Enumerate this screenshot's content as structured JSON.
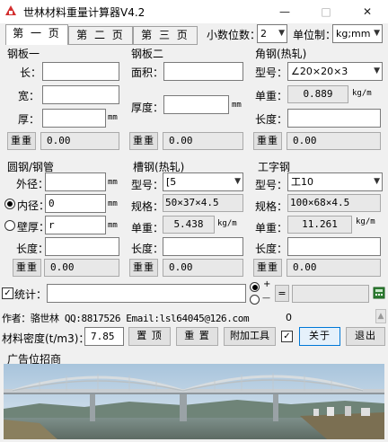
{
  "window": {
    "title": "世林材料重量计算器V4.2",
    "minimize": "—",
    "maximize": "□",
    "close": "✕"
  },
  "tabs": [
    {
      "label": "第 一 页",
      "active": true
    },
    {
      "label": "第 二 页",
      "active": false
    },
    {
      "label": "第 三 页",
      "active": false
    }
  ],
  "settings": {
    "decimals_label": "小数位数：",
    "decimals_value": "2",
    "unit_label": "单位制：",
    "unit_value": "kg;mm"
  },
  "plate1": {
    "title": "钢板一",
    "length_label": "长：",
    "width_label": "宽：",
    "thickness_label": "厚：",
    "length_value": "",
    "width_value": "",
    "thickness_value": "",
    "thickness_unit": "mm",
    "weight_button": "重重",
    "result": "0.00"
  },
  "plate2": {
    "title": "钢板二",
    "area_label": "面积：",
    "thickness_label": "厚度：",
    "area_value": "",
    "thickness_value": "",
    "thickness_unit": "mm",
    "weight_button": "重重",
    "result": "0.00"
  },
  "angle": {
    "title": "角钢(热轧)",
    "model_label": "型号：",
    "model_value": "∠20×20×3",
    "unit_weight_label": "单重：",
    "unit_weight_value": "0.889",
    "unit_weight_unit": "kg/m",
    "length_label": "长度：",
    "length_value": "",
    "weight_button": "重重",
    "result": "0.00"
  },
  "round": {
    "title": "圆钢/钢管",
    "outer_label": "外径：",
    "outer_value": "",
    "outer_unit": "mm",
    "inner_label": "内径：",
    "inner_value": "0",
    "inner_unit": "mm",
    "wall_label": "壁厚：",
    "wall_value": "r",
    "wall_unit": "mm",
    "length_label": "长度：",
    "length_value": "",
    "weight_button": "重重",
    "result": "0.00"
  },
  "channel": {
    "title": "槽钢(热轧)",
    "model_label": "型号：",
    "model_value": "[5",
    "spec_label": "规格：",
    "spec_value": "50×37×4.5",
    "unit_weight_label": "单重：",
    "unit_weight_value": "5.438",
    "unit_weight_unit": "kg/m",
    "length_label": "长度：",
    "length_value": "",
    "weight_button": "重重",
    "result": "0.00"
  },
  "ibeam": {
    "title": "工字钢",
    "model_label": "型号：",
    "model_value": "工10",
    "spec_label": "规格：",
    "spec_value": "100×68×4.5",
    "unit_weight_label": "单重：",
    "unit_weight_value": "11.261",
    "unit_weight_unit": "kg/m",
    "length_label": "长度：",
    "length_value": "",
    "weight_button": "重重",
    "result": "0.00"
  },
  "stats": {
    "label": "统计：",
    "value": "",
    "plus": "+",
    "minus": "—",
    "equals": "=",
    "result": ""
  },
  "footer": {
    "author": "作者：骆世林 QQ:8817526  Email:lsl64045@126.com",
    "counter": "0",
    "density_label": "材料密度(t/m3)：",
    "density_value": "7.85",
    "pin_button": "置 顶",
    "reset_button": "重 置",
    "addon_button": "附加工具",
    "about_button": "关于",
    "exit_button": "退出"
  },
  "ad": {
    "title": "广告位招商"
  }
}
